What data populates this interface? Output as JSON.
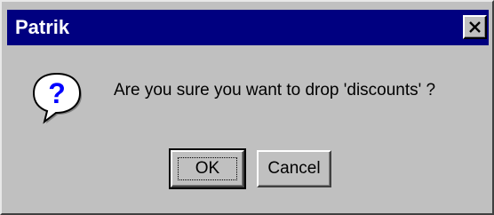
{
  "window": {
    "title": "Patrik",
    "close_glyph": "✕"
  },
  "dialog": {
    "icon": "question-icon",
    "message": "Are you sure you want to drop 'discounts' ?"
  },
  "buttons": {
    "ok_label": "OK",
    "cancel_label": "Cancel"
  },
  "colors": {
    "titlebar": "#000080",
    "face": "#c0c0c0",
    "icon_fill": "#ffffff",
    "icon_glyph": "#0000ff"
  }
}
